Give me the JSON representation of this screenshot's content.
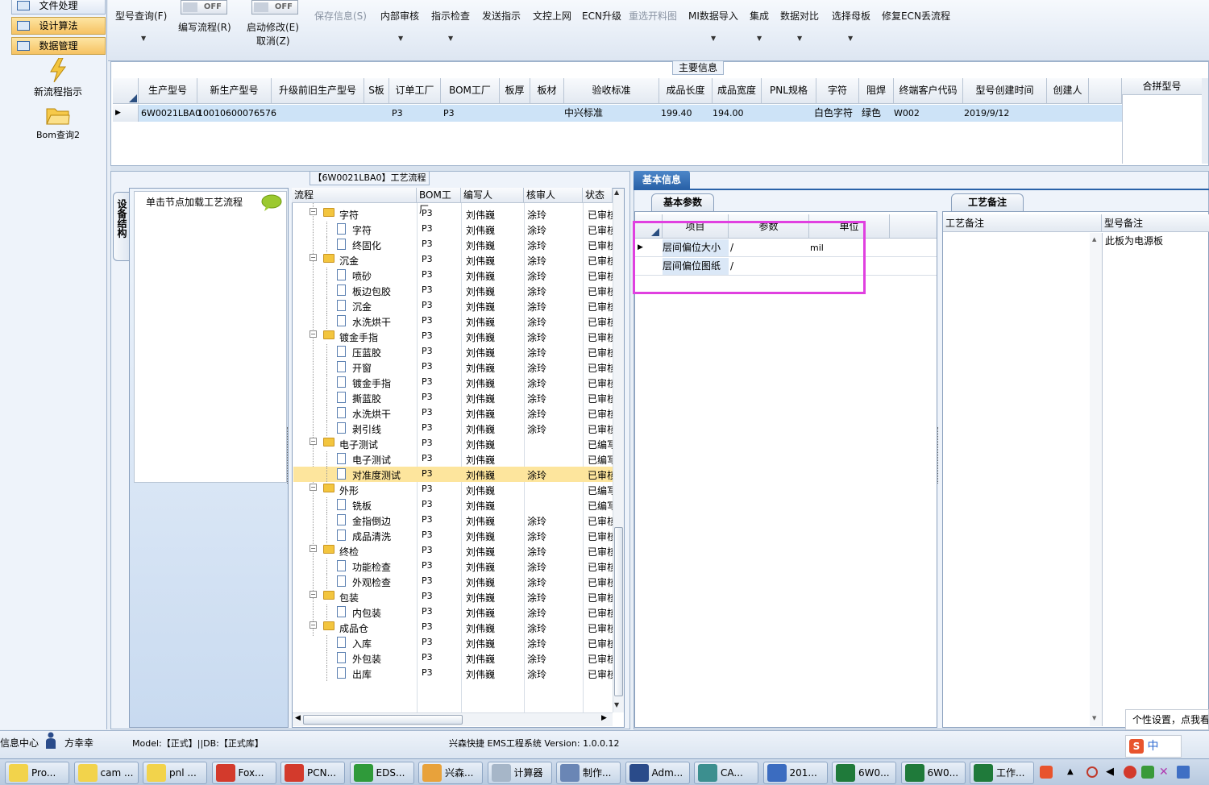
{
  "left_nav": {
    "items": [
      {
        "label": "文件处理"
      },
      {
        "label": "设计算法"
      },
      {
        "label": "数据管理"
      }
    ],
    "shortcuts": [
      {
        "label": "新流程指示",
        "icon": "lightning-icon"
      },
      {
        "label": "Bom查询2",
        "icon": "folder-icon"
      }
    ]
  },
  "toolbar": {
    "model_query": "型号查询(F)",
    "write_flow": "编写流程(R)",
    "start_modify": "启动修改(E)",
    "cancel": "取消(Z)",
    "toggle_off": "OFF",
    "save_info": "保存信息(S)",
    "internal_review": "内部审核",
    "instruction_check": "指示检查",
    "send_instruction": "发送指示",
    "upload": "文控上网",
    "ecn_upgrade": "ECN升级",
    "reselect_material": "重选开料图",
    "mi_import": "MI数据导入",
    "integrate": "集成",
    "data_compare": "数据对比",
    "select_template": "选择母板",
    "repair_ecn": "修复ECN丢流程"
  },
  "main_info": {
    "title": "主要信息",
    "columns": [
      "生产型号",
      "新生产型号",
      "升级前旧生产型号",
      "S板",
      "订单工厂",
      "BOM工厂",
      "板厚",
      "板材",
      "验收标准",
      "成品长度",
      "成品宽度",
      "PNL规格",
      "字符",
      "阻焊",
      "终端客户代码",
      "型号创建时间",
      "创建人"
    ],
    "row": {
      "production_model": "6W0021LBA0",
      "new_model": "10010600076576",
      "order_factory": "P3",
      "bom_factory": "P3",
      "standard": "中兴标准",
      "length": "199.40",
      "width": "194.00",
      "character": "白色字符",
      "solder_mask": "绿色",
      "customer_code": "W002",
      "created": "2019/9/12"
    },
    "merge_model_header": "合拼型号"
  },
  "process_panel": {
    "title": "【6W0021LBA0】工艺流程",
    "side_tab": "设备结构",
    "hint": "单击节点加载工艺流程",
    "columns": [
      "流程",
      "BOM工厂",
      "编写人",
      "核审人",
      "状态"
    ],
    "rows": [
      {
        "name": "字符",
        "folder": true,
        "factory": "P3",
        "writer": "刘伟巍",
        "reviewer": "涂玲",
        "status": "已审核"
      },
      {
        "name": "字符",
        "folder": false,
        "factory": "P3",
        "writer": "刘伟巍",
        "reviewer": "涂玲",
        "status": "已审核"
      },
      {
        "name": "终固化",
        "folder": false,
        "factory": "P3",
        "writer": "刘伟巍",
        "reviewer": "涂玲",
        "status": "已审核"
      },
      {
        "name": "沉金",
        "folder": true,
        "factory": "P3",
        "writer": "刘伟巍",
        "reviewer": "涂玲",
        "status": "已审核"
      },
      {
        "name": "喷砂",
        "folder": false,
        "factory": "P3",
        "writer": "刘伟巍",
        "reviewer": "涂玲",
        "status": "已审核"
      },
      {
        "name": "板边包胶",
        "folder": false,
        "factory": "P3",
        "writer": "刘伟巍",
        "reviewer": "涂玲",
        "status": "已审核"
      },
      {
        "name": "沉金",
        "folder": false,
        "factory": "P3",
        "writer": "刘伟巍",
        "reviewer": "涂玲",
        "status": "已审核"
      },
      {
        "name": "水洗烘干",
        "folder": false,
        "factory": "P3",
        "writer": "刘伟巍",
        "reviewer": "涂玲",
        "status": "已审核"
      },
      {
        "name": "镀金手指",
        "folder": true,
        "factory": "P3",
        "writer": "刘伟巍",
        "reviewer": "涂玲",
        "status": "已审核"
      },
      {
        "name": "压蓝胶",
        "folder": false,
        "factory": "P3",
        "writer": "刘伟巍",
        "reviewer": "涂玲",
        "status": "已审核"
      },
      {
        "name": "开窗",
        "folder": false,
        "factory": "P3",
        "writer": "刘伟巍",
        "reviewer": "涂玲",
        "status": "已审核"
      },
      {
        "name": "镀金手指",
        "folder": false,
        "factory": "P3",
        "writer": "刘伟巍",
        "reviewer": "涂玲",
        "status": "已审核"
      },
      {
        "name": "撕蓝胶",
        "folder": false,
        "factory": "P3",
        "writer": "刘伟巍",
        "reviewer": "涂玲",
        "status": "已审核"
      },
      {
        "name": "水洗烘干",
        "folder": false,
        "factory": "P3",
        "writer": "刘伟巍",
        "reviewer": "涂玲",
        "status": "已审核"
      },
      {
        "name": "剥引线",
        "folder": false,
        "factory": "P3",
        "writer": "刘伟巍",
        "reviewer": "涂玲",
        "status": "已审核"
      },
      {
        "name": "电子测试",
        "folder": true,
        "factory": "P3",
        "writer": "刘伟巍",
        "reviewer": "",
        "status": "已编写"
      },
      {
        "name": "电子测试",
        "folder": false,
        "factory": "P3",
        "writer": "刘伟巍",
        "reviewer": "",
        "status": "已编写"
      },
      {
        "name": "对准度测试",
        "folder": false,
        "factory": "P3",
        "writer": "刘伟巍",
        "reviewer": "涂玲",
        "status": "已审核",
        "selected": true
      },
      {
        "name": "外形",
        "folder": true,
        "factory": "P3",
        "writer": "刘伟巍",
        "reviewer": "",
        "status": "已编写"
      },
      {
        "name": "铣板",
        "folder": false,
        "factory": "P3",
        "writer": "刘伟巍",
        "reviewer": "",
        "status": "已编写"
      },
      {
        "name": "金指倒边",
        "folder": false,
        "factory": "P3",
        "writer": "刘伟巍",
        "reviewer": "涂玲",
        "status": "已审核"
      },
      {
        "name": "成品清洗",
        "folder": false,
        "factory": "P3",
        "writer": "刘伟巍",
        "reviewer": "涂玲",
        "status": "已审核"
      },
      {
        "name": "终检",
        "folder": true,
        "factory": "P3",
        "writer": "刘伟巍",
        "reviewer": "涂玲",
        "status": "已审核"
      },
      {
        "name": "功能检查",
        "folder": false,
        "factory": "P3",
        "writer": "刘伟巍",
        "reviewer": "涂玲",
        "status": "已审核"
      },
      {
        "name": "外观检查",
        "folder": false,
        "factory": "P3",
        "writer": "刘伟巍",
        "reviewer": "涂玲",
        "status": "已审核"
      },
      {
        "name": "包装",
        "folder": true,
        "factory": "P3",
        "writer": "刘伟巍",
        "reviewer": "涂玲",
        "status": "已审核"
      },
      {
        "name": "内包装",
        "folder": false,
        "factory": "P3",
        "writer": "刘伟巍",
        "reviewer": "涂玲",
        "status": "已审核"
      },
      {
        "name": "成品仓",
        "folder": true,
        "factory": "P3",
        "writer": "刘伟巍",
        "reviewer": "涂玲",
        "status": "已审核"
      },
      {
        "name": "入库",
        "folder": false,
        "factory": "P3",
        "writer": "刘伟巍",
        "reviewer": "涂玲",
        "status": "已审核"
      },
      {
        "name": "外包装",
        "folder": false,
        "factory": "P3",
        "writer": "刘伟巍",
        "reviewer": "涂玲",
        "status": "已审核"
      },
      {
        "name": "出库",
        "folder": false,
        "factory": "P3",
        "writer": "刘伟巍",
        "reviewer": "涂玲",
        "status": "已审核"
      }
    ]
  },
  "basic_info": {
    "tab": "基本信息",
    "sub_tab": "基本参数",
    "columns": [
      "项目",
      "参数",
      "单位"
    ],
    "rows": [
      {
        "item": "层间偏位大小",
        "param": "/",
        "unit": "mil"
      },
      {
        "item": "层间偏位图纸",
        "param": "/",
        "unit": ""
      }
    ]
  },
  "process_notes": {
    "tab": "工艺备注",
    "col_notes": "工艺备注",
    "col_model_notes": "型号备注",
    "model_note": "此板为电源板"
  },
  "status_bar": {
    "info_center": "信息中心",
    "user": "方幸幸",
    "model": "Model:【正式】||DB:【正式库】",
    "system": "兴森快捷 EMS工程系统 Version: 1.0.0.12",
    "popup": "个性设置，点我看"
  },
  "taskbar": {
    "items": [
      {
        "label": "Pro...",
        "color": "#f2d34b"
      },
      {
        "label": "cam ...",
        "color": "#f2d34b"
      },
      {
        "label": "pnl ...",
        "color": "#f2d34b"
      },
      {
        "label": "Fox...",
        "color": "#d33a2c"
      },
      {
        "label": "PCN...",
        "color": "#d33a2c"
      },
      {
        "label": "EDS...",
        "color": "#2f9a3a"
      },
      {
        "label": "兴森...",
        "color": "#e8a23b"
      },
      {
        "label": "计算器",
        "color": "#a6b6c8"
      },
      {
        "label": "制作...",
        "color": "#6a86b5"
      },
      {
        "label": "Adm...",
        "color": "#2a4b8a"
      },
      {
        "label": "CA...",
        "color": "#3c8f8f"
      },
      {
        "label": "201...",
        "color": "#3b6cc0"
      },
      {
        "label": "6W0...",
        "color": "#1f7a3a"
      },
      {
        "label": "6W0...",
        "color": "#1f7a3a"
      },
      {
        "label": "工作...",
        "color": "#1f7a3a"
      }
    ],
    "ime": "中"
  }
}
